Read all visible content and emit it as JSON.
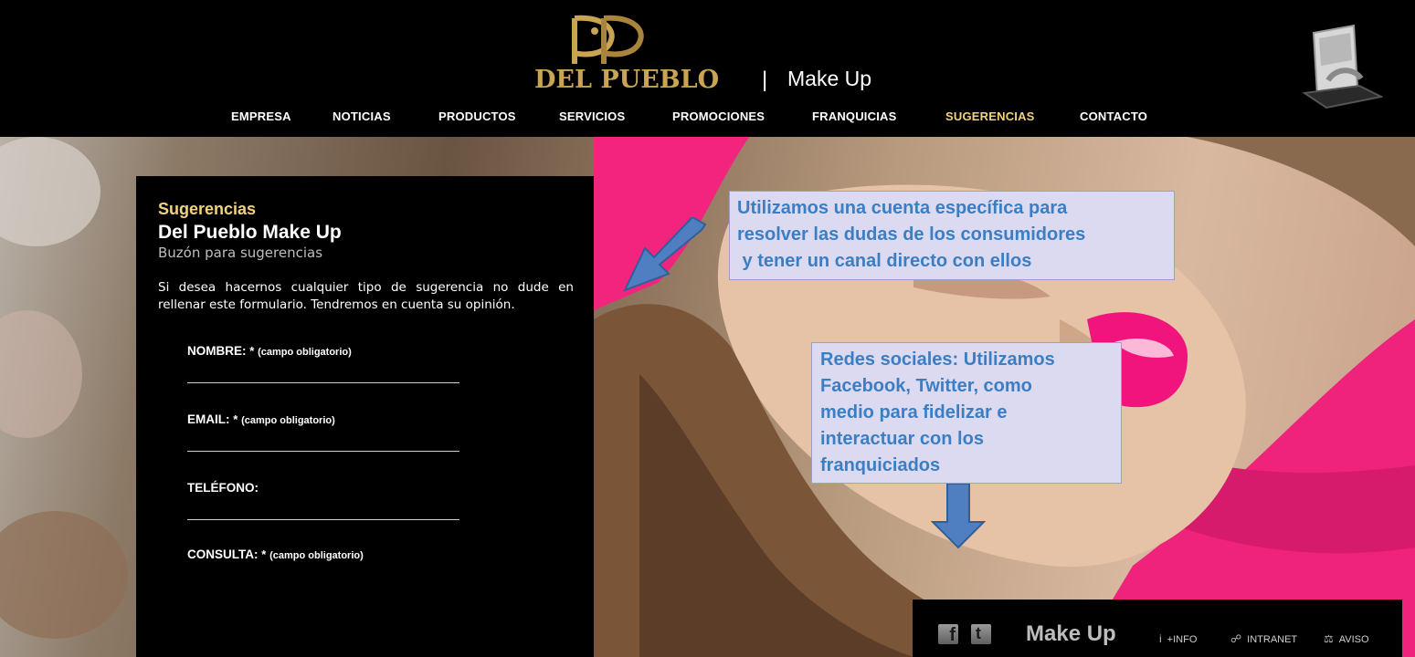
{
  "header": {
    "brand_name": "DEL PUEBLO",
    "brand_separator": "|",
    "brand_tagline": "Make Up",
    "nav": [
      {
        "label": "EMPRESA"
      },
      {
        "label": "NOTICIAS"
      },
      {
        "label": "PRODUCTOS"
      },
      {
        "label": "SERVICIOS"
      },
      {
        "label": "PROMOCIONES"
      },
      {
        "label": "FRANQUICIAS"
      },
      {
        "label": "SUGERENCIAS",
        "active": true
      },
      {
        "label": "CONTACTO"
      }
    ]
  },
  "form_panel": {
    "section": "Sugerencias",
    "title": "Del Pueblo Make Up",
    "subtitle": "Buzón para sugerencias",
    "description": "Si desea hacernos cualquier tipo de sugerencia no dude en rellenar este formulario. Tendremos en cuenta su opinión.",
    "fields": [
      {
        "label": "NOMBRE:",
        "required_mark": "*",
        "note": "(campo obligatorio)",
        "value": ""
      },
      {
        "label": "EMAIL:",
        "required_mark": "*",
        "note": "(campo obligatorio)",
        "value": ""
      },
      {
        "label": "TELÉFONO:",
        "required_mark": "",
        "note": "",
        "value": ""
      },
      {
        "label": "CONSULTA:",
        "required_mark": "*",
        "note": "(campo obligatorio)",
        "value": ""
      }
    ]
  },
  "annotations": {
    "note1": {
      "lines": [
        "Utilizamos una cuenta específica para",
        "resolver las dudas de los consumidores",
        " y tener un canal directo con ellos"
      ]
    },
    "note2": {
      "lines": [
        "Redes sociales: Utilizamos",
        "Facebook, Twitter, como",
        "medio para fidelizar e",
        "interactuar con los",
        "franquiciados"
      ]
    },
    "arrow_color": "#4f7fc0"
  },
  "footer": {
    "social": [
      {
        "icon": "facebook-icon",
        "glyph": "f"
      },
      {
        "icon": "twitter-icon",
        "glyph": "t"
      }
    ],
    "brand": "Make Up",
    "links": [
      {
        "icon": "info-icon",
        "glyph": "i",
        "label": "+INFO"
      },
      {
        "icon": "intranet-icon",
        "glyph": "☍",
        "label": "INTRANET"
      },
      {
        "icon": "scales-icon",
        "glyph": "⚖",
        "label": "AVISO"
      }
    ]
  },
  "colors": {
    "accent_gold": "#f2d27a",
    "logo_gold": "#c9a453",
    "annotation_bg": "#dcdaf0",
    "annotation_text": "#3b7ec4"
  }
}
